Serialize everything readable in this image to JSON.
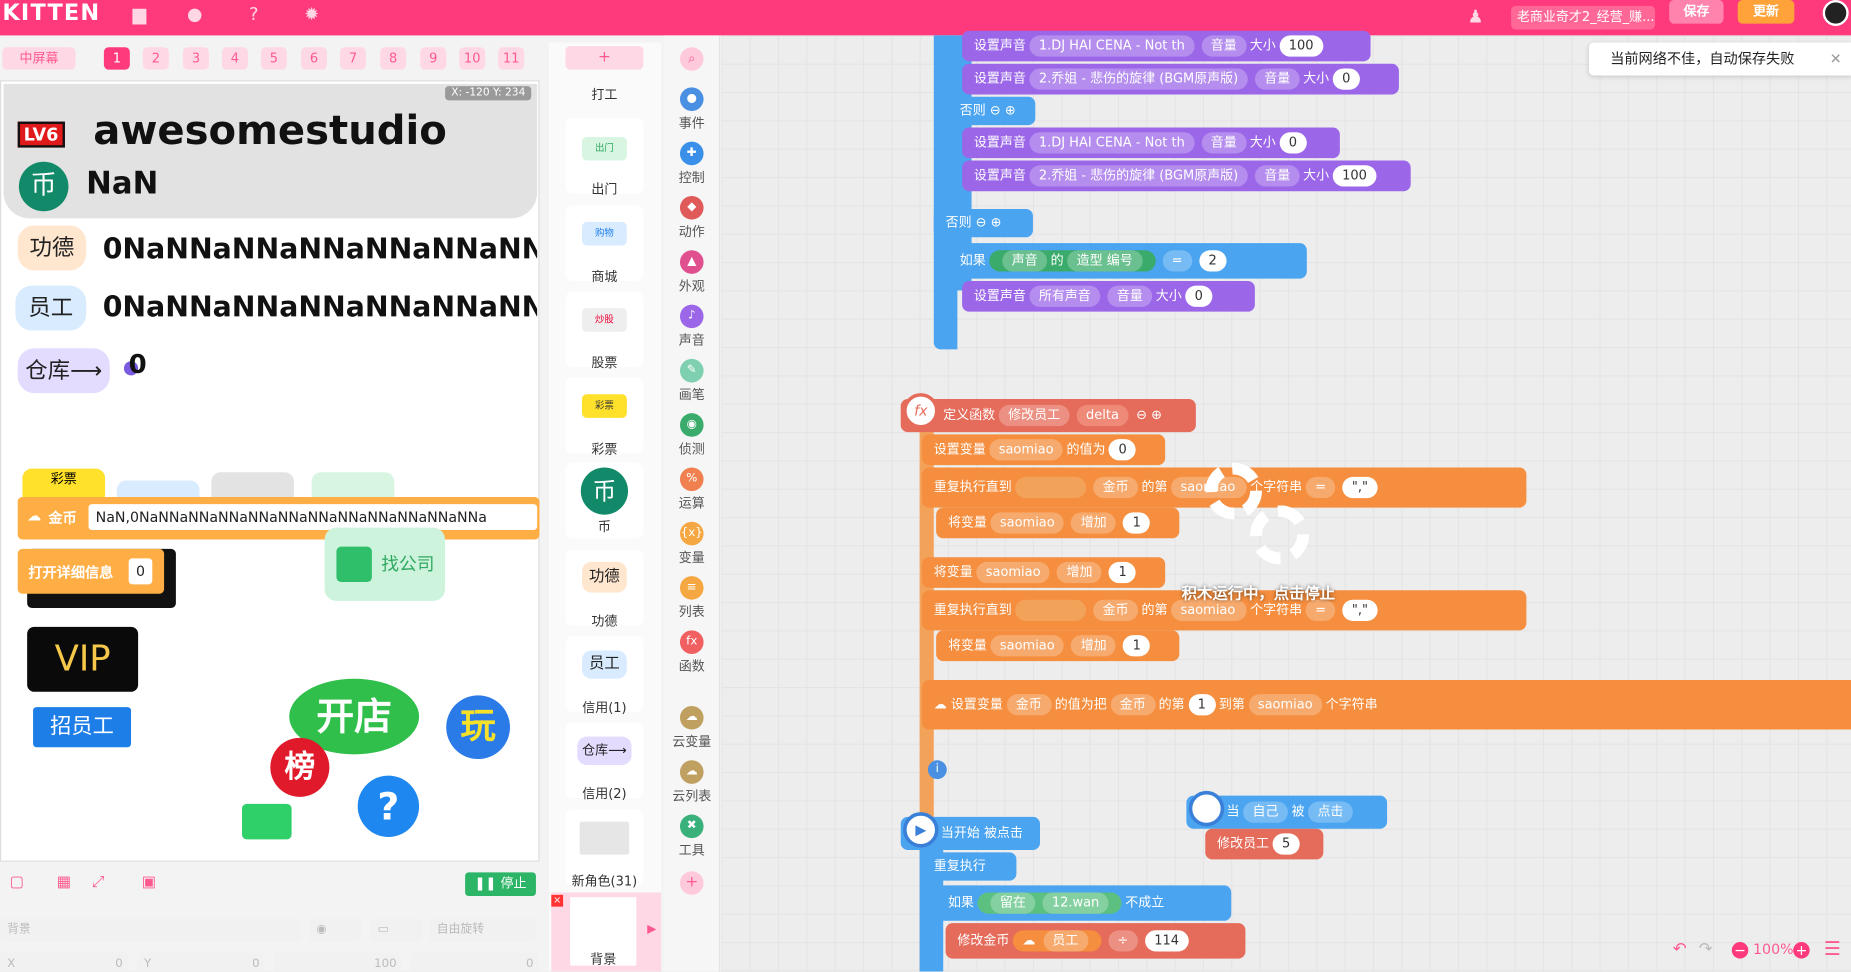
{
  "app": {
    "logo": "KITTEN",
    "project_title": "老商业奇才2_经营_赚...",
    "save_label": "保存",
    "update_label": "更新"
  },
  "colors": {
    "brand": "#ff3a7c",
    "purple_block": "#9b67e8",
    "blue_block": "#4aa4f0",
    "orange_block": "#f58e3e"
  },
  "stage_toolbar": {
    "screen_btn": "中屏幕",
    "scene_tabs": [
      "1",
      "2",
      "3",
      "4",
      "5",
      "6",
      "7",
      "8",
      "9",
      "10",
      "11"
    ],
    "active_tab": "1",
    "coords": "X: -120  Y: 234"
  },
  "stage": {
    "logo_badge": "LV6",
    "studio_name": "awesomestudio",
    "coin_icon": "币",
    "coin_value": "NaN",
    "merit_label": "功德",
    "merit_value": "0NaNNaNNaNNaNNaNNaNNa",
    "staff_label": "员工",
    "staff_value": "0NaNNaNNaNNaNNaNNaNNa",
    "warehouse_label": "仓库⟶",
    "warehouse_value": "0",
    "coin_var_label": "金币",
    "coin_var_value": "NaN,0NaNNaNNaNNaNNaNNaNNaNNaNNaNNaNNaNNa",
    "detail_label": "打开详细信息",
    "detail_value": "0",
    "find_company": "找公司",
    "vip": "VIP",
    "hire": "招员工",
    "open_shop": "开店",
    "rank": "榜",
    "play": "玩",
    "help": "?",
    "sprite_lottery": "彩票"
  },
  "stage_bottom": {
    "stop_label": "停止",
    "bg_placeholder": "背景",
    "rotate_label": "自由旋转",
    "x_label": "X",
    "x_value": "0",
    "y_label": "Y",
    "y_value": "0",
    "size_value": "100",
    "dir_value": "0"
  },
  "sprites": {
    "add": "+",
    "items": [
      {
        "label": "打工",
        "icon": ""
      },
      {
        "label": "出门",
        "icon": "出门"
      },
      {
        "label": "商城",
        "icon": "购物"
      },
      {
        "label": "股票",
        "icon": "炒股"
      },
      {
        "label": "彩票",
        "icon": "彩票"
      },
      {
        "label": "币",
        "icon": "币"
      },
      {
        "label": "功德",
        "icon": "功德"
      },
      {
        "label": "信用(1)",
        "icon": "员工"
      },
      {
        "label": "信用(2)",
        "icon": "仓库⟶"
      },
      {
        "label": "新角色(31)",
        "icon": ""
      }
    ],
    "background": "背景"
  },
  "categories": [
    {
      "label": "事件",
      "color": "#4a90e2",
      "glyph": "●"
    },
    {
      "label": "控制",
      "color": "#3a8fe8",
      "glyph": "✚"
    },
    {
      "label": "动作",
      "color": "#e05a5a",
      "glyph": "◆"
    },
    {
      "label": "外观",
      "color": "#e0508f",
      "glyph": "▲"
    },
    {
      "label": "声音",
      "color": "#9b67e8",
      "glyph": "♪"
    },
    {
      "label": "画笔",
      "color": "#7fd0b0",
      "glyph": "✎"
    },
    {
      "label": "侦测",
      "color": "#3aab6a",
      "glyph": "◉"
    },
    {
      "label": "运算",
      "color": "#f08050",
      "glyph": "%"
    },
    {
      "label": "变量",
      "color": "#f5a742",
      "glyph": "{x}"
    },
    {
      "label": "列表",
      "color": "#f5a742",
      "glyph": "≡"
    },
    {
      "label": "函数",
      "color": "#f06060",
      "glyph": "fx"
    },
    {
      "label": "云变量",
      "color": "#c0a060",
      "glyph": "☁"
    },
    {
      "label": "云列表",
      "color": "#c0a060",
      "glyph": "☁"
    },
    {
      "label": "工具",
      "color": "#3ab07a",
      "glyph": "✖"
    }
  ],
  "blocks": {
    "set_sound": "设置声音",
    "volume": "音量",
    "size": "大小",
    "else": "否则",
    "if": "如果",
    "sound1": "1.DJ HAI CENA - Not th",
    "sound2": "2.乔姐 - 悲伤的旋律 (BGM原声版)",
    "v100": "100",
    "v0": "0",
    "sound_var": "声音",
    "of": "的",
    "costume": "造型 编号",
    "eq": "=",
    "v2": "2",
    "all_sounds": "所有声音",
    "define_fn": "定义函数",
    "fn_name": "修改员工",
    "param": "delta",
    "set_var": "设置变量",
    "saomiao": "saomiao",
    "value_is": "的值为",
    "repeat_until": "重复执行直到",
    "coin": "金币",
    "nth": "的第",
    "nth_char": "个字符串",
    "quote": "\",\"",
    "change_var": "将变量",
    "increase": "增加",
    "v1": "1",
    "take": "把",
    "to": "到第",
    "running": "积木运行中，点击停止",
    "when": "当",
    "self": "自己",
    "be": "被",
    "clicked": "点击",
    "fn_call": "修改员工",
    "v5": "5",
    "when_start": "当开始 被点击",
    "forever": "重复执行",
    "stay": "留在",
    "wan": "12.wan",
    "not_hold": "不成立",
    "change_coin": "修改金币",
    "staff": "员工",
    "div": "÷",
    "v114": "114"
  },
  "notice": "当前网络不佳，自动保存失败",
  "zoom": "100%"
}
